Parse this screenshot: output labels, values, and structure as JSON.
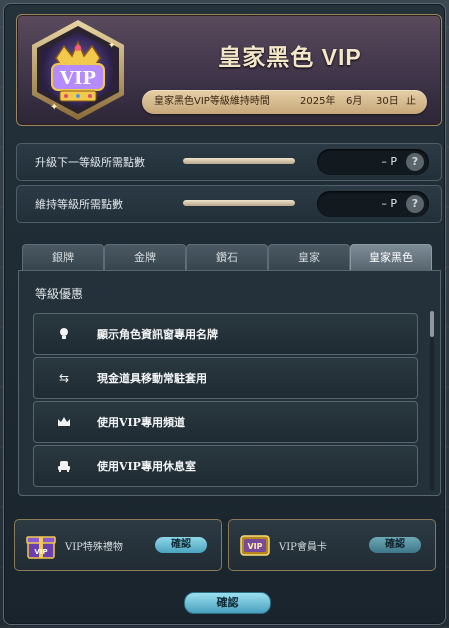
{
  "header": {
    "title": "皇家黑色 VIP",
    "badge_text": "VIP",
    "maintain_label": "皇家黑色VIP等級維持時間",
    "year": "2025年",
    "month": "6月",
    "day": "30日",
    "suffix": "止"
  },
  "points": [
    {
      "label": "升級下一等級所需點數",
      "value": "– P",
      "help": "?",
      "progress": 1.0
    },
    {
      "label": "維持等級所需點數",
      "value": "– P",
      "help": "?",
      "progress": 1.0
    }
  ],
  "tabs": [
    {
      "label": "銀牌"
    },
    {
      "label": "金牌"
    },
    {
      "label": "鑽石"
    },
    {
      "label": "皇家"
    },
    {
      "label": "皇家黑色",
      "active": true
    }
  ],
  "benefits": {
    "title": "等級優惠",
    "items": [
      {
        "icon": "bulb-icon",
        "label": "顯示角色資訊窗專用名牌"
      },
      {
        "icon": "swap-arrows-icon",
        "label": "現金道具移動常駐套用"
      },
      {
        "icon": "crown-icon",
        "label": "使用VIP專用頻道"
      },
      {
        "icon": "lounge-chair-icon",
        "label": "使用VIP專用休息室"
      }
    ]
  },
  "cards": [
    {
      "icon": "vip-gift-box-icon",
      "label": "VIP特殊禮物",
      "button": "確認"
    },
    {
      "icon": "vip-member-card-icon",
      "label": "VIP會員卡",
      "button": "確認"
    }
  ],
  "confirm_label": "確認",
  "colors": {
    "gold": "#c7a77b",
    "accent_button": "#4aa0bd",
    "panel": "#24313a"
  }
}
